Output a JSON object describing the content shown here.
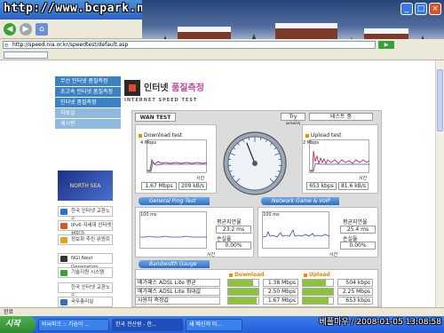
{
  "browser": {
    "watermark": "http://www.bcpark.net",
    "address": "http://speed.nia.or.kr/speedtest/default.asp",
    "status": "완료"
  },
  "sidebar": {
    "items": [
      {
        "label": "무선 인터넷 품질측정"
      },
      {
        "label": "초고속 인터넷 품질측정"
      },
      {
        "label": "인터넷 품질측정"
      },
      {
        "label": "자료실"
      },
      {
        "label": "게시판"
      }
    ],
    "banner_text": "NORTH SEA",
    "links": [
      {
        "label": "한국 인터넷 교환노드"
      },
      {
        "label": "IPv6 자세대 인터넷 체험관"
      },
      {
        "label": "정보화 추진 위원회"
      },
      {
        "label": "NGI Next Generation"
      },
      {
        "label": "기술지원 시스템"
      },
      {
        "label": "한국 인터넷 교환노드"
      },
      {
        "label": "국무총리실"
      }
    ]
  },
  "logo": {
    "title_part1": "인터넷 ",
    "title_part2": "품질측정",
    "subtitle": "INTERNET SPEED TEST"
  },
  "panel": {
    "tab_label": "WAN TEST",
    "try_again": "Try again",
    "test_name": "테스트 중",
    "download": {
      "title": "Download test",
      "scale": "4 Mbps",
      "axis_label": "시간",
      "speed": "1.67 Mbps",
      "kbps": "209 kB/s"
    },
    "upload": {
      "title": "Upload test",
      "scale": "2 Mbps",
      "axis_label": "시간",
      "speed": "653 kbps",
      "kbps": "81.6 kB/s"
    },
    "gauge": {
      "needle_fraction": 0.42
    },
    "ping": {
      "title": "General Ping Test",
      "scale": "100 ms",
      "ylabel": "평균지연",
      "avg_label": "평균지연율",
      "avg_value": "23.2 ms",
      "loss_label": "손실율",
      "loss_value": "0.00%",
      "axis_label": "시간"
    },
    "voip": {
      "title": "Network Game & VoIP Test",
      "scale": "100 ms",
      "ylabel": "평균지연",
      "avg_label": "평균지연율",
      "avg_value": "25.4 ms",
      "loss_label": "손실율",
      "loss_value": "0.00%",
      "axis_label": "시간"
    },
    "bandwidth": {
      "title": "Bandwidth Gauge",
      "download_header": "Download",
      "upload_header": "Upload",
      "rows": [
        {
          "label": "메가패스 ADSL Lite 평균",
          "down": "1.38 Mbps",
          "down_fill": 0.83,
          "up": "504 kbps",
          "up_fill": 0.77
        },
        {
          "label": "메가패스 ADSL Lite 최대값",
          "down": "2.50 Mbps",
          "down_fill": 1.0,
          "up": "2.25 Mbps",
          "up_fill": 1.0
        },
        {
          "label": "사용자 측정값",
          "down": "1.67 Mbps",
          "down_fill": 0.95,
          "up": "653 kbps",
          "up_fill": 0.85
        }
      ]
    }
  },
  "taskbar": {
    "start": "시작",
    "tasks": [
      {
        "label": "비씨파크 :: 가슴이 ..."
      },
      {
        "label": "한국 전산원 - 한..."
      },
      {
        "label": "새 메신저 타..."
      }
    ],
    "datestamp": "베플마우 / 2008-01-05 13:08:58"
  }
}
